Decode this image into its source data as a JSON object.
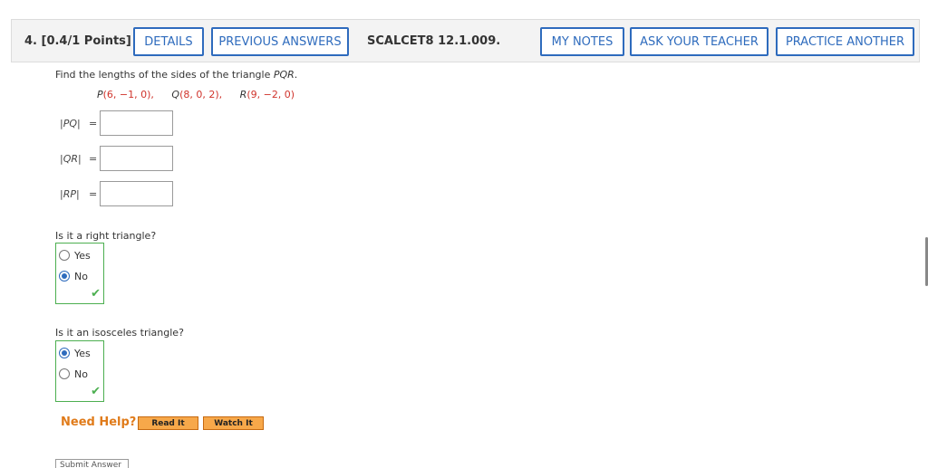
{
  "header": {
    "question_number": "4. [0.4/1 Points]",
    "buttons": {
      "details": "DETAILS",
      "previous_answers": "PREVIOUS ANSWERS",
      "my_notes": "MY NOTES",
      "ask_teacher": "ASK YOUR TEACHER",
      "practice_another": "PRACTICE ANOTHER"
    },
    "code": "SCALCET8 12.1.009."
  },
  "problem": {
    "prompt_prefix": "Find the lengths of the sides of the triangle ",
    "prompt_italic": "PQR",
    "prompt_suffix": ".",
    "points": [
      {
        "label": "P",
        "coords": "(6, −1, 0),"
      },
      {
        "label": "Q",
        "coords": "(8, 0, 2),"
      },
      {
        "label": "R",
        "coords": "(9, −2, 0)"
      }
    ]
  },
  "answers": [
    {
      "label": "PQ",
      "value": ""
    },
    {
      "label": "QR",
      "value": ""
    },
    {
      "label": "RP",
      "value": ""
    }
  ],
  "right_triangle": {
    "question": "Is it a right triangle?",
    "options": [
      "Yes",
      "No"
    ],
    "selected": "No",
    "status": "correct"
  },
  "isosceles": {
    "question": "Is it an isosceles triangle?",
    "options": [
      "Yes",
      "No"
    ],
    "selected": "Yes",
    "status": "correct"
  },
  "help": {
    "label": "Need Help?",
    "read_it": "Read It",
    "watch_it": "Watch It"
  },
  "submit": "Submit Answer",
  "colors": {
    "accent": "#2e6bbd",
    "correct": "#4caf50",
    "point_red": "#d0342c",
    "help_orange": "#e07b1a"
  }
}
